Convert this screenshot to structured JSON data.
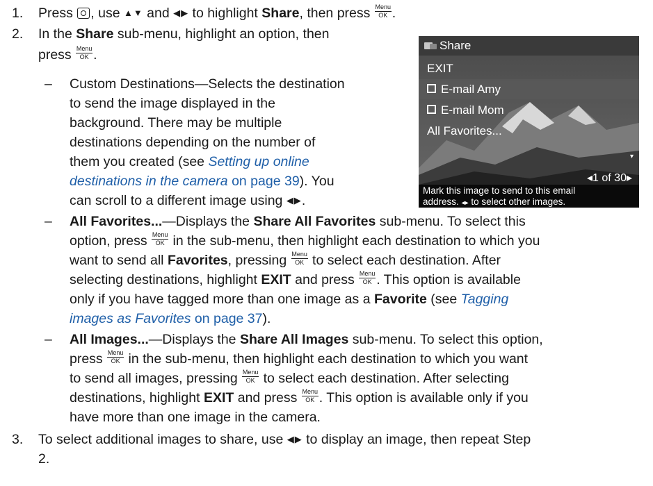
{
  "steps": {
    "s1": {
      "num": "1.",
      "a": "Press",
      "b": ", use",
      "c": "and",
      "d": "to highlight",
      "e": "Share",
      "f": ", then press",
      "g": "."
    },
    "s2": {
      "num": "2.",
      "l1a": "In the",
      "l1b": "Share",
      "l1c": "sub-menu, highlight an option, then",
      "l2a": "press",
      "l2b": "."
    },
    "s3": {
      "num": "3.",
      "l1a": "To select additional images to share, use",
      "l1b": "to display an image, then repeat Step",
      "l2": "2."
    }
  },
  "bullets": {
    "dash": "–",
    "custom": {
      "l1": "Custom Destinations—Selects the destination",
      "l2": "to send the image displayed in the",
      "l3": "background. There may be multiple",
      "l4": "destinations depending on the number of",
      "l5a": "them you created (see",
      "l5b": "Setting up online",
      "l6a": "destinations in the camera",
      "l6b": "on page 39",
      "l6c": "). You",
      "l7a": "can scroll to a different image using",
      "l7b": "."
    },
    "favorites": {
      "l1a": "All Favorites...",
      "l1b": "—Displays the",
      "l1c": "Share All Favorites",
      "l1d": "sub-menu. To select this",
      "l2a": "option, press",
      "l2b": "in the sub-menu, then highlight each destination to which you",
      "l3a": "want to send all",
      "l3b": "Favorites",
      "l3c": ", pressing",
      "l3d": "to select each destination. After",
      "l4a": "selecting destinations, highlight",
      "l4b": "EXIT",
      "l4c": "and press",
      "l4d": ". This option is available",
      "l5a": "only if you have tagged more than one image as a",
      "l5b": "Favorite",
      "l5c": "(see",
      "l5d": "Tagging",
      "l6a": "images as Favorites",
      "l6b": "on page 37",
      "l6c": ")."
    },
    "images": {
      "l1a": "All Images...",
      "l1b": "—Displays the",
      "l1c": "Share All Images",
      "l1d": "sub-menu. To select this option,",
      "l2a": "press",
      "l2b": "in the sub-menu, then highlight each destination to which you want",
      "l3a": "to send all images, pressing",
      "l3b": "to select each destination. After selecting",
      "l4a": "destinations, highlight",
      "l4b": "EXIT",
      "l4c": "and press",
      "l4d": ". This option is available only if you",
      "l5": "have more than one image in the camera."
    }
  },
  "glyphs": {
    "menu_ok_top": "Menu",
    "menu_ok_bottom": "OK",
    "up_down": "▲▼",
    "left_right": "◀▶",
    "small_left_right": "◂▸"
  },
  "camera_screen": {
    "title": "Share",
    "items": [
      "EXIT",
      "E-mail Amy",
      "E-mail Mom",
      "All Favorites..."
    ],
    "counter": "1 of 30",
    "counter_left": "◂",
    "counter_right": "▸",
    "more_arrow": "▾",
    "caption_l1": "Mark this image to send to this email",
    "caption_l2a": "address.",
    "caption_l2b": "to select other images.",
    "colors": {
      "title_bar": "#3a3a3a",
      "caption_bar": "#0a0a0a",
      "text": "#ffffff"
    }
  },
  "colors": {
    "link": "#1f5fa8",
    "text": "#1a1a1a"
  }
}
